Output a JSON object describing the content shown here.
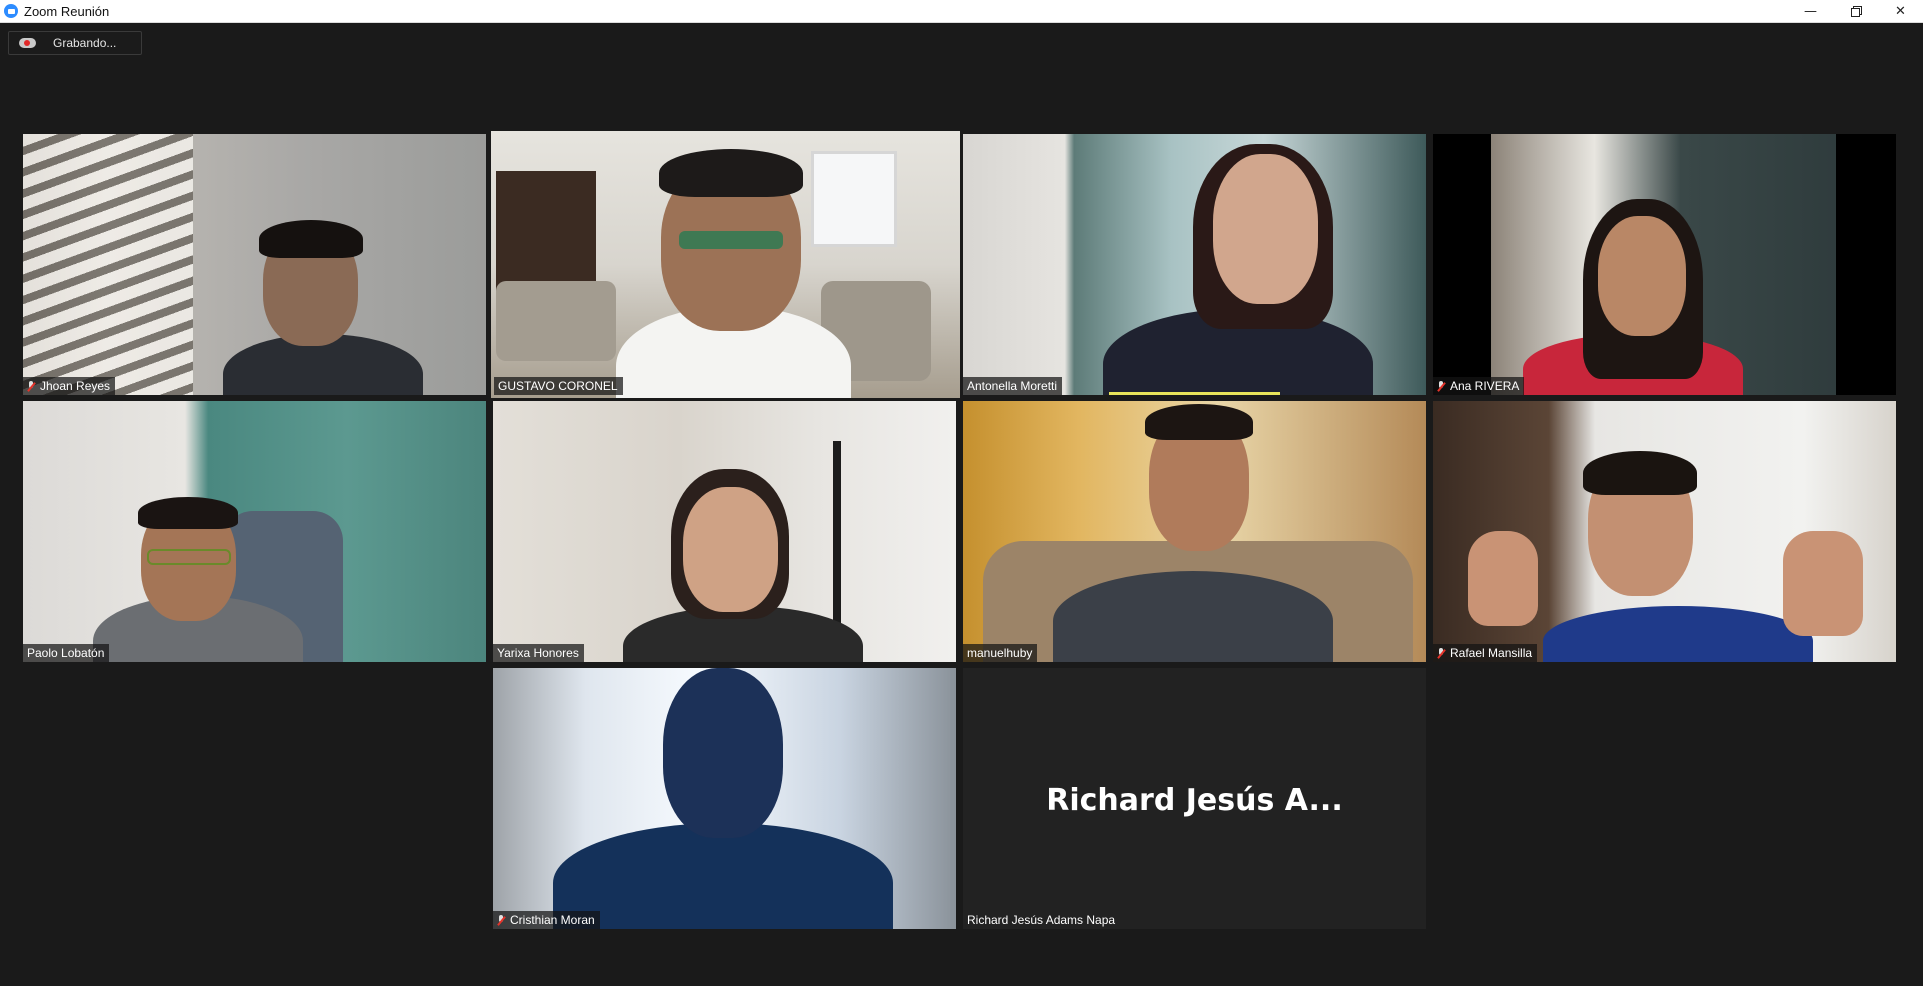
{
  "window": {
    "title": "Zoom Reunión",
    "controls": {
      "minimize": "—",
      "restore": "restore-icon",
      "close": "✕"
    }
  },
  "recording": {
    "label": "Grabando...",
    "icon": "cloud-record-icon"
  },
  "colors": {
    "background": "#1a1a1a",
    "active_speaker_border": "#d7e86a",
    "mute_red": "#e5332a",
    "zoom_blue": "#2d8cff"
  },
  "participants": [
    {
      "name": "Jhoan Reyes",
      "muted": true
    },
    {
      "name": "GUSTAVO CORONEL",
      "muted": false,
      "active_speaker": true
    },
    {
      "name": "Antonella Moretti",
      "muted": false,
      "speaking": true
    },
    {
      "name": "Ana RIVERA",
      "muted": true
    },
    {
      "name": "Paolo Lobatón",
      "muted": false
    },
    {
      "name": "Yarixa Honores",
      "muted": false
    },
    {
      "name": "manuelhuby",
      "muted": false
    },
    {
      "name": "Rafael Mansilla",
      "muted": true
    },
    {
      "name": "Cristhian Moran",
      "muted": true
    },
    {
      "name": "Richard Jesús Adams Napa",
      "muted": false,
      "video_off": true,
      "display_name_large": "Richard Jesús A..."
    }
  ]
}
